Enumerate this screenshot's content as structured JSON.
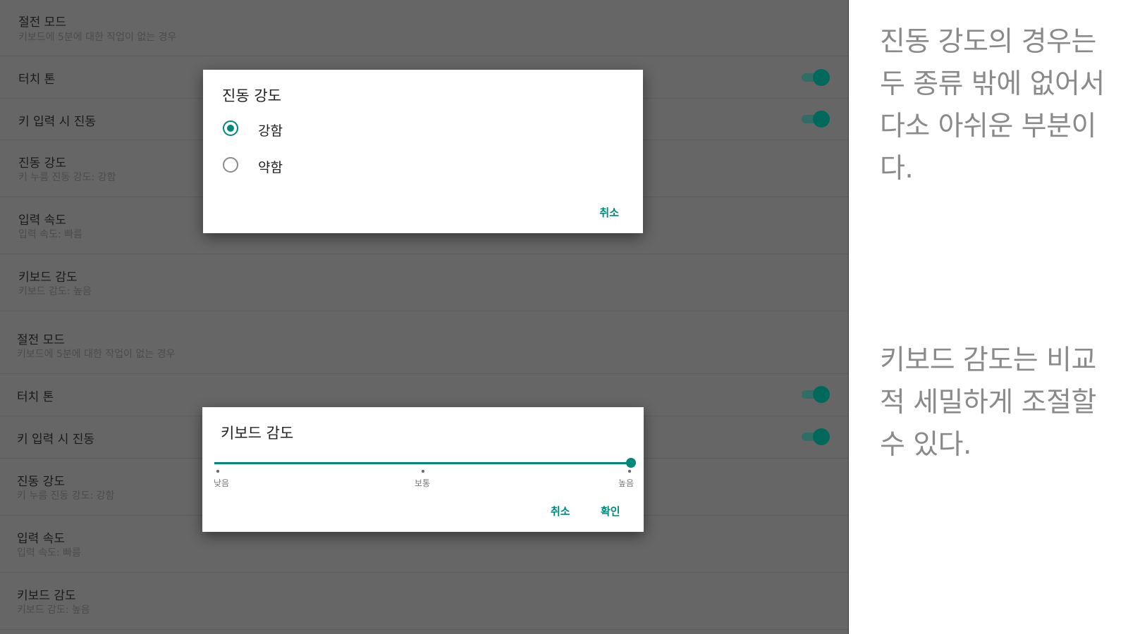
{
  "top_panel": {
    "rows": [
      {
        "title": "절전 모드",
        "subtitle": "키보드에 5분에 대한 작업이 없는 경우"
      },
      {
        "title": "터치 톤"
      },
      {
        "title": "키 입력 시 진동"
      },
      {
        "title": "진동 강도",
        "subtitle": "키 누름 진동 강도: 강함"
      },
      {
        "title": "입력 속도",
        "subtitle": "입력 속도: 빠름"
      },
      {
        "title": "키보드 감도",
        "subtitle": "키보드 감도: 높음"
      }
    ],
    "toggles": {
      "touch_tone": true,
      "key_vibration": true
    },
    "dialog": {
      "title": "진동 강도",
      "options": [
        {
          "label": "강함",
          "selected": true
        },
        {
          "label": "약함",
          "selected": false
        }
      ],
      "cancel_label": "취소"
    }
  },
  "bottom_panel": {
    "rows": [
      {
        "title": "절전 모드",
        "subtitle": "키보드에 5분에 대한 작업이 없는 경우"
      },
      {
        "title": "터치 톤"
      },
      {
        "title": "키 입력 시 진동"
      },
      {
        "title": "진동 강도",
        "subtitle": "키 누름 진동 강도: 강함"
      },
      {
        "title": "입력 속도",
        "subtitle": "입력 속도: 빠름"
      },
      {
        "title": "키보드 감도",
        "subtitle": "키보드 감도: 높음"
      }
    ],
    "toggles": {
      "touch_tone": true,
      "key_vibration": true
    },
    "dialog": {
      "title": "키보드 감도",
      "slider": {
        "labels": [
          "낮음",
          "보통",
          "높음"
        ],
        "value": "높음"
      },
      "cancel_label": "취소",
      "ok_label": "확인"
    }
  },
  "notes": {
    "top": "진동 강도의 경우는 두 종류 밖에 없어서 다소 아쉬운 부분이 다.",
    "bottom": "키보드 감도는 비교적 세밀하게 조절할 수 있다."
  },
  "colors": {
    "accent": "#00897b",
    "toggle_thumb": "#00695c",
    "panel_bg": "#666666"
  }
}
